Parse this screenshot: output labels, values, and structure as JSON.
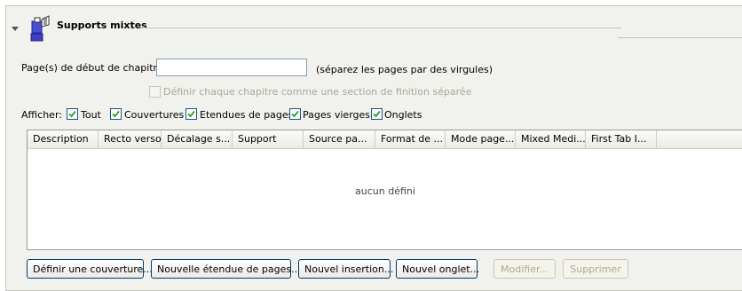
{
  "section": {
    "title": "Supports mixtes",
    "icon": "document-media-icon"
  },
  "chapter": {
    "label": "Page(s) de début de chapitre:",
    "value": "",
    "hint": "(séparez les pages par des virgules)",
    "finishing_checkbox": {
      "label": "Définir chaque chapitre comme une section de finition séparée",
      "checked": false,
      "enabled": false
    }
  },
  "show": {
    "label": "Afficher:",
    "options": [
      {
        "label": "Tout",
        "checked": true
      },
      {
        "label": "Couvertures",
        "checked": true
      },
      {
        "label": "Etendues de pages",
        "checked": true
      },
      {
        "label": "Pages vierges",
        "checked": true
      },
      {
        "label": "Onglets",
        "checked": true
      }
    ]
  },
  "table": {
    "columns": [
      "Description",
      "Recto verso",
      "Décalage s...",
      "Support",
      "Source pa...",
      "Format de ...",
      "Mode page...",
      "Mixed Medi...",
      "First Tab I..."
    ],
    "empty_message": "aucun défini",
    "rows": []
  },
  "buttons": {
    "define_cover": "Définir une couverture...",
    "new_page_range": "Nouvelle étendue de pages...",
    "new_insert": "Nouvel insertion...",
    "new_tab": "Nouvel onglet...",
    "modify": "Modifier...",
    "delete": "Supprimer"
  },
  "colors": {
    "panel_bg": "#f1f1ed",
    "checkbox_border": "#1c5180",
    "checkmark": "#21a121",
    "button_border": "#003c74",
    "disabled_text": "#aca899"
  }
}
